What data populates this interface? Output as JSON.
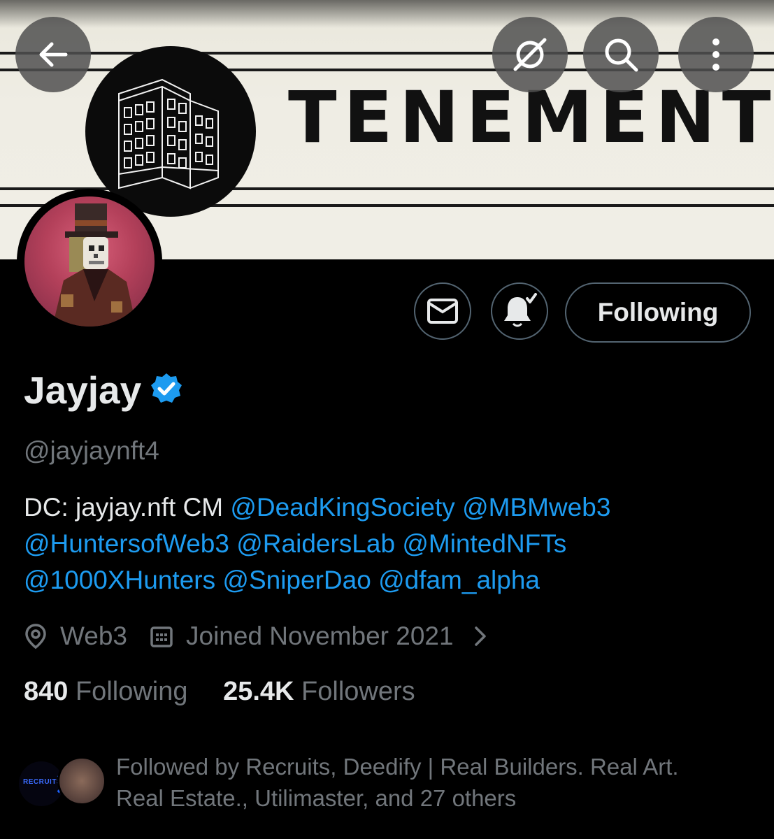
{
  "banner": {
    "brand": "TENEMENT"
  },
  "toolbar": {
    "back_icon": "arrow-left-icon",
    "hide_icon": "eye-slash-icon",
    "search_icon": "search-icon",
    "more_icon": "more-vertical-icon"
  },
  "profile": {
    "name": "Jayjay",
    "handle": "@jayjaynft4",
    "verified_color": "#1d9bf0",
    "bio_prefix": "DC: jayjay.nft CM ",
    "mentions": [
      "@DeadKingSociety",
      "@MBMweb3",
      "@HuntersofWeb3",
      "@RaidersLab",
      "@MintedNFTs",
      "@1000XHunters",
      "@SniperDao",
      "@dfam_alpha"
    ],
    "location": "Web3",
    "joined": "Joined November 2021",
    "following_count": "840",
    "following_label": "Following",
    "followers_count": "25.4K",
    "followers_label": "Followers"
  },
  "actions": {
    "follow_label": "Following",
    "message_icon": "mail-icon",
    "notify_icon": "bell-check-icon"
  },
  "followed_by": {
    "line1": "Followed by Recruits, Deedify | Real Builders. Real Art.",
    "line2": "Real Estate., Utilimaster, and 27 others",
    "mini_logo_text": "RECRUITS"
  },
  "colors": {
    "accent": "#1d9bf0",
    "muted": "#71767b",
    "text": "#e7e9ea",
    "border": "#536471"
  }
}
